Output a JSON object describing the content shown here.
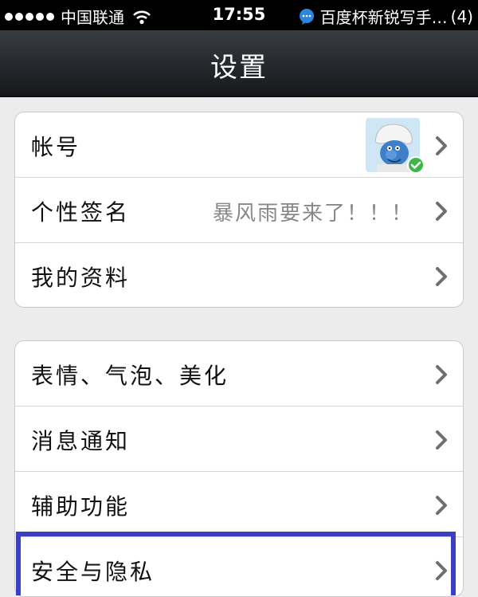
{
  "status_bar": {
    "carrier": "中国联通",
    "time": "17:55",
    "notification_text": "百度杯新锐写手…",
    "notification_count": "(4)",
    "icons": [
      "signal-dots-icon",
      "wifi-icon",
      "message-bubble-icon"
    ]
  },
  "nav": {
    "title": "设置"
  },
  "groups": [
    {
      "rows": [
        {
          "label": "帐号",
          "value": "",
          "has_avatar": true,
          "verified": true
        },
        {
          "label": "个性签名",
          "value": "暴风雨要来了！！！"
        },
        {
          "label": "我的资料",
          "value": ""
        }
      ]
    },
    {
      "rows": [
        {
          "label": "表情、气泡、美化"
        },
        {
          "label": "消息通知"
        },
        {
          "label": "辅助功能"
        },
        {
          "label": "安全与隐私",
          "highlighted": true
        }
      ]
    }
  ],
  "colors": {
    "background": "#ececec",
    "highlight_border": "#3a3fc4",
    "verified_badge": "#3fb54a",
    "value_text": "#888888"
  }
}
